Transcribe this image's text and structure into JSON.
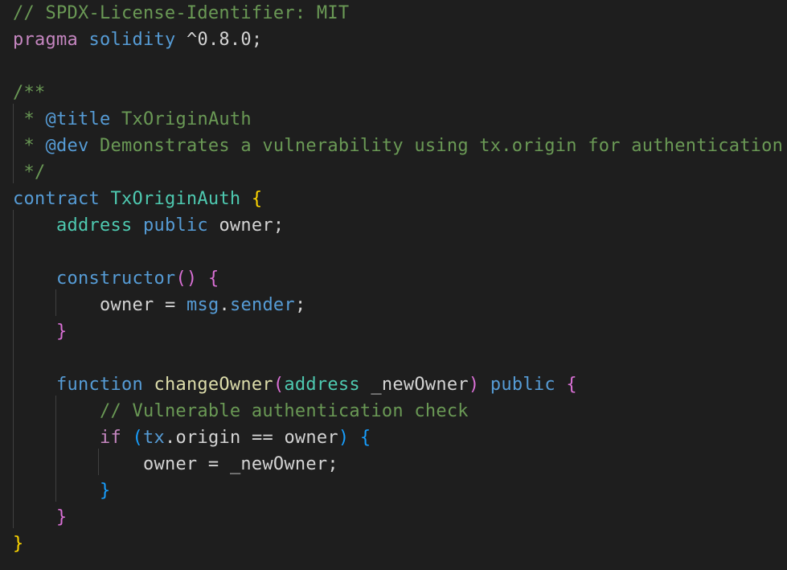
{
  "colors": {
    "background": "#1e1e1e",
    "comment": "#6a9955",
    "keyword_control": "#c586c0",
    "keyword": "#569cd6",
    "type": "#4ec9b0",
    "function": "#dcdcaa",
    "variable": "#9cdcfe",
    "text": "#d4d4d4",
    "bracket_level_1": "#ffd700",
    "bracket_level_2": "#da70d6",
    "bracket_level_3": "#179fff"
  },
  "code": {
    "line1": "// SPDX-License-Identifier: MIT",
    "line2": {
      "pragma": "pragma",
      "solidity": "solidity",
      "version": " ^0.8.0;"
    },
    "line4": "/**",
    "line5": {
      "prefix": " * ",
      "tag": "@title",
      "text": " TxOriginAuth"
    },
    "line6": {
      "prefix": " * ",
      "tag": "@dev",
      "text": " Demonstrates a vulnerability using tx.origin for authentication"
    },
    "line7": " */",
    "line8": {
      "contract": "contract",
      "name": "TxOriginAuth",
      "brace": "{"
    },
    "line9": {
      "type": "address",
      "visibility": "public",
      "var": "owner",
      "semi": ";"
    },
    "line11": {
      "name": "constructor",
      "parens": "()",
      "brace": "{"
    },
    "line12": {
      "var": "owner",
      "op": " = ",
      "msg": "msg",
      "dot": ".",
      "sender": "sender",
      "semi": ";"
    },
    "line13": "}",
    "line15": {
      "function": "function",
      "name": "changeOwner",
      "lparen": "(",
      "type": "address",
      "param": "_newOwner",
      "rparen": ")",
      "visibility": "public",
      "brace": "{"
    },
    "line16": "// Vulnerable authentication check",
    "line17": {
      "if": "if",
      "lparen": "(",
      "tx": "tx",
      "dot": ".",
      "origin": "origin",
      "op": " == ",
      "owner": "owner",
      "rparen": ")",
      "brace": "{"
    },
    "line18": {
      "var": "owner",
      "op": " = ",
      "value": "_newOwner",
      "semi": ";"
    },
    "line19": "}",
    "line20": "}",
    "line21": "}"
  }
}
